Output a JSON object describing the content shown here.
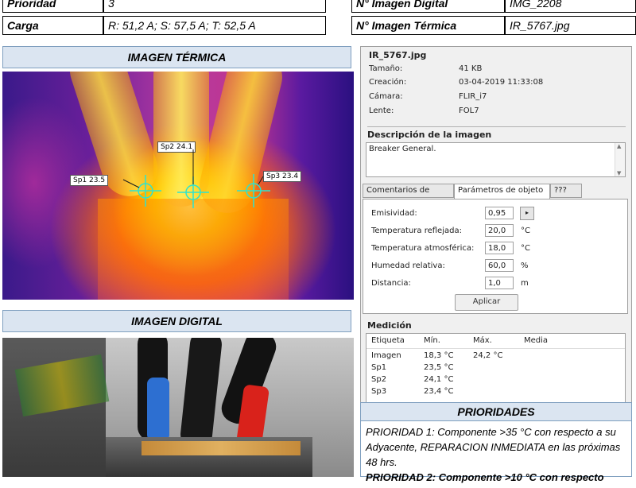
{
  "header": {
    "prioridad_label": "Prioridad",
    "prioridad_value": "3",
    "carga_label": "Carga",
    "carga_value": "R: 51,2 A; S: 57,5 A; T: 52,5 A",
    "img_digital_label": "N° Imagen Digital",
    "img_digital_value": "IMG_2208",
    "img_termica_label": "N° Imagen Térmica",
    "img_termica_value": "IR_5767.jpg"
  },
  "sections": {
    "thermal_title": "IMAGEN TÉRMICA",
    "digital_title": "IMAGEN DIGITAL"
  },
  "spots": [
    {
      "label": "Sp1 23.5"
    },
    {
      "label": "Sp2 24.1"
    },
    {
      "label": "Sp3 23.4"
    }
  ],
  "panel": {
    "filename": "IR_5767.jpg",
    "info": [
      {
        "label": "Tamaño:",
        "value": "41 KB"
      },
      {
        "label": "Creación:",
        "value": "03-04-2019 11:33:08"
      },
      {
        "label": "Cámara:",
        "value": "FLIR_i7"
      },
      {
        "label": "Lente:",
        "value": "FOL7"
      }
    ],
    "desc_title": "Descripción de la imagen",
    "desc_text": "Breaker General.",
    "tabs": [
      "Comentarios de texto",
      "Parámetros de objeto",
      "???"
    ],
    "params": [
      {
        "label": "Emisividad:",
        "value": "0,95",
        "unit": ""
      },
      {
        "label": "Temperatura reflejada:",
        "value": "20,0",
        "unit": "°C"
      },
      {
        "label": "Temperatura atmosférica:",
        "value": "18,0",
        "unit": "°C"
      },
      {
        "label": "Humedad relativa:",
        "value": "60,0",
        "unit": "%"
      },
      {
        "label": "Distancia:",
        "value": "1,0",
        "unit": "m"
      }
    ],
    "apply_label": "Aplicar",
    "measure_title": "Medición",
    "measure_headers": [
      "Etiqueta",
      "Mín.",
      "Máx.",
      "Media"
    ],
    "measure_rows": [
      {
        "etiqueta": "Imagen",
        "min": "18,3 °C",
        "max": "24,2 °C",
        "media": ""
      },
      {
        "etiqueta": "Sp1",
        "min": "23,5 °C",
        "max": "",
        "media": ""
      },
      {
        "etiqueta": "Sp2",
        "min": "24,1 °C",
        "max": "",
        "media": ""
      },
      {
        "etiqueta": "Sp3",
        "min": "23,4 °C",
        "max": "",
        "media": ""
      }
    ]
  },
  "prioridades": {
    "title": "PRIORIDADES",
    "text1": "PRIORIDAD 1: Componente >35 °C con respecto a su Adyacente, REPARACION INMEDIATA en las próximas 48 hrs.",
    "text2": "PRIORIDAD 2: Componente >10 °C con respecto"
  }
}
